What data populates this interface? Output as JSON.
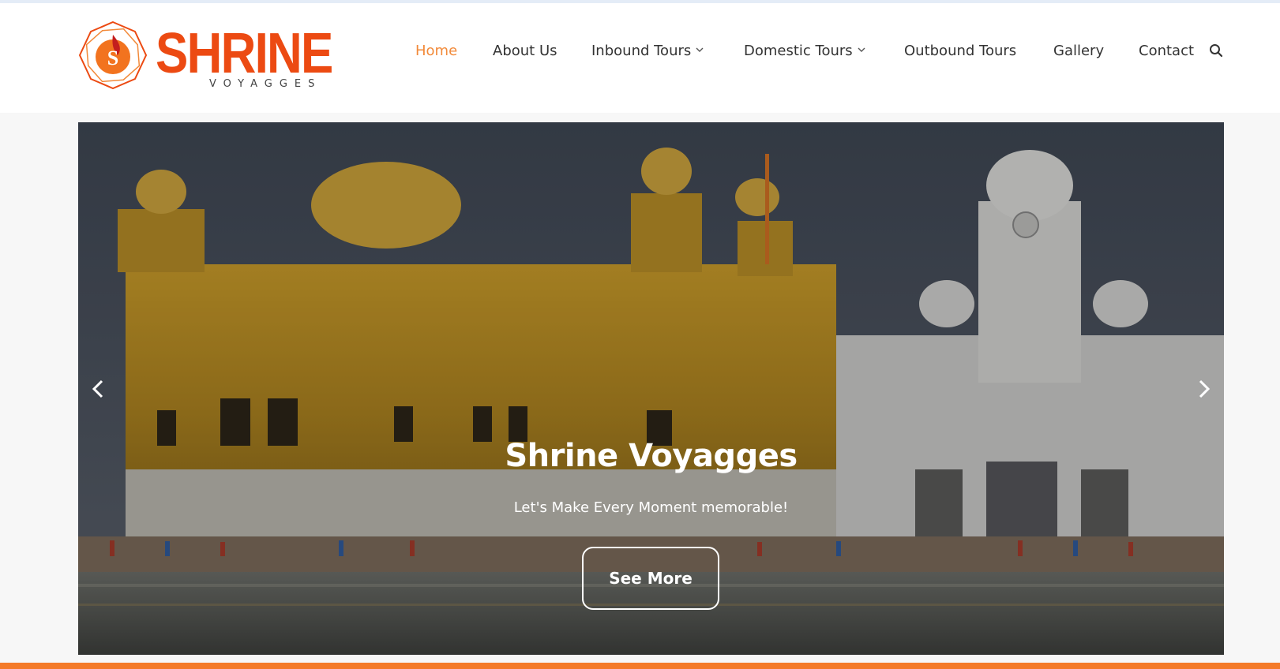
{
  "brand": {
    "name": "SHRINE",
    "tagline": "VOYAGGES",
    "color": "#ec4a12",
    "emblem_letter": "S"
  },
  "nav": {
    "items": [
      {
        "label": "Home",
        "active": true
      },
      {
        "label": "About Us"
      },
      {
        "label": "Inbound Tours",
        "dropdown": true
      },
      {
        "label": "Domestic Tours",
        "dropdown": true
      },
      {
        "label": "Outbound Tours"
      },
      {
        "label": "Gallery"
      },
      {
        "label": "Contact"
      }
    ],
    "active_color": "#f28a3a",
    "search_icon": "search-icon"
  },
  "hero": {
    "title": "Shrine Voyagges",
    "subtitle": "Let's Make Every Moment memorable!",
    "button_label": "See More",
    "prev_icon": "chevron-left-icon",
    "next_icon": "chevron-right-icon"
  },
  "accent_color": "#f47a28"
}
